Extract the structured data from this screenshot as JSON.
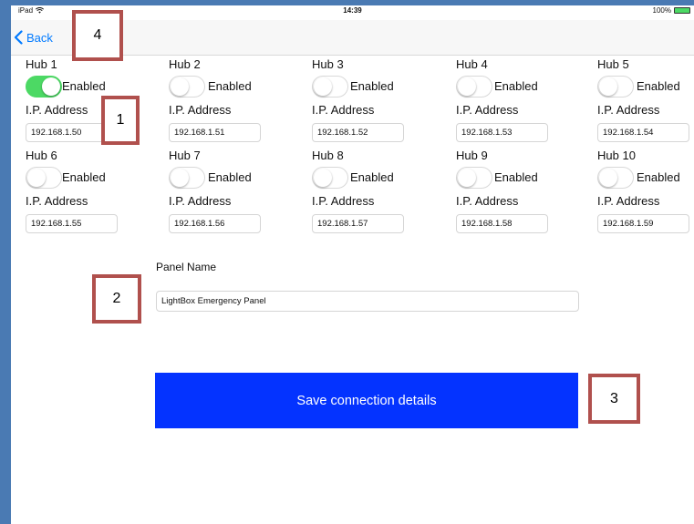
{
  "status_bar": {
    "device": "iPad",
    "time": "14:39",
    "battery": "100%",
    "battery_level": 1.0
  },
  "nav": {
    "back_label": "Back"
  },
  "hubs": [
    {
      "title": "Hub 1",
      "enabled_label": "Enabled",
      "enabled": true,
      "ip_label": "I.P. Address",
      "ip": "192.168.1.50"
    },
    {
      "title": "Hub 2",
      "enabled_label": "Enabled",
      "enabled": false,
      "ip_label": "I.P. Address",
      "ip": "192.168.1.51"
    },
    {
      "title": "Hub 3",
      "enabled_label": "Enabled",
      "enabled": false,
      "ip_label": "I.P. Address",
      "ip": "192.168.1.52"
    },
    {
      "title": "Hub 4",
      "enabled_label": "Enabled",
      "enabled": false,
      "ip_label": "I.P. Address",
      "ip": "192.168.1.53"
    },
    {
      "title": "Hub 5",
      "enabled_label": "Enabled",
      "enabled": false,
      "ip_label": "I.P. Address",
      "ip": "192.168.1.54"
    },
    {
      "title": "Hub 6",
      "enabled_label": "Enabled",
      "enabled": false,
      "ip_label": "I.P. Address",
      "ip": "192.168.1.55"
    },
    {
      "title": "Hub 7",
      "enabled_label": "Enabled",
      "enabled": false,
      "ip_label": "I.P. Address",
      "ip": "192.168.1.56"
    },
    {
      "title": "Hub 8",
      "enabled_label": "Enabled",
      "enabled": false,
      "ip_label": "I.P. Address",
      "ip": "192.168.1.57"
    },
    {
      "title": "Hub 9",
      "enabled_label": "Enabled",
      "enabled": false,
      "ip_label": "I.P. Address",
      "ip": "192.168.1.58"
    },
    {
      "title": "Hub 10",
      "enabled_label": "Enabled",
      "enabled": false,
      "ip_label": "I.P. Address",
      "ip": "192.168.1.59"
    }
  ],
  "panel": {
    "label": "Panel Name",
    "value": "LightBox Emergency Panel"
  },
  "save_button": {
    "label": "Save connection details"
  },
  "callouts": {
    "c1": "1",
    "c2": "2",
    "c3": "3",
    "c4": "4"
  },
  "colors": {
    "accent": "#007aff",
    "toggle_on": "#4cd964",
    "save_button_bg": "#0433ff",
    "callout_border": "#b0504d",
    "frame": "#4a7ab3"
  },
  "icons": {
    "back": "chevron-left-icon",
    "wifi": "wifi-icon",
    "battery": "battery-icon"
  }
}
